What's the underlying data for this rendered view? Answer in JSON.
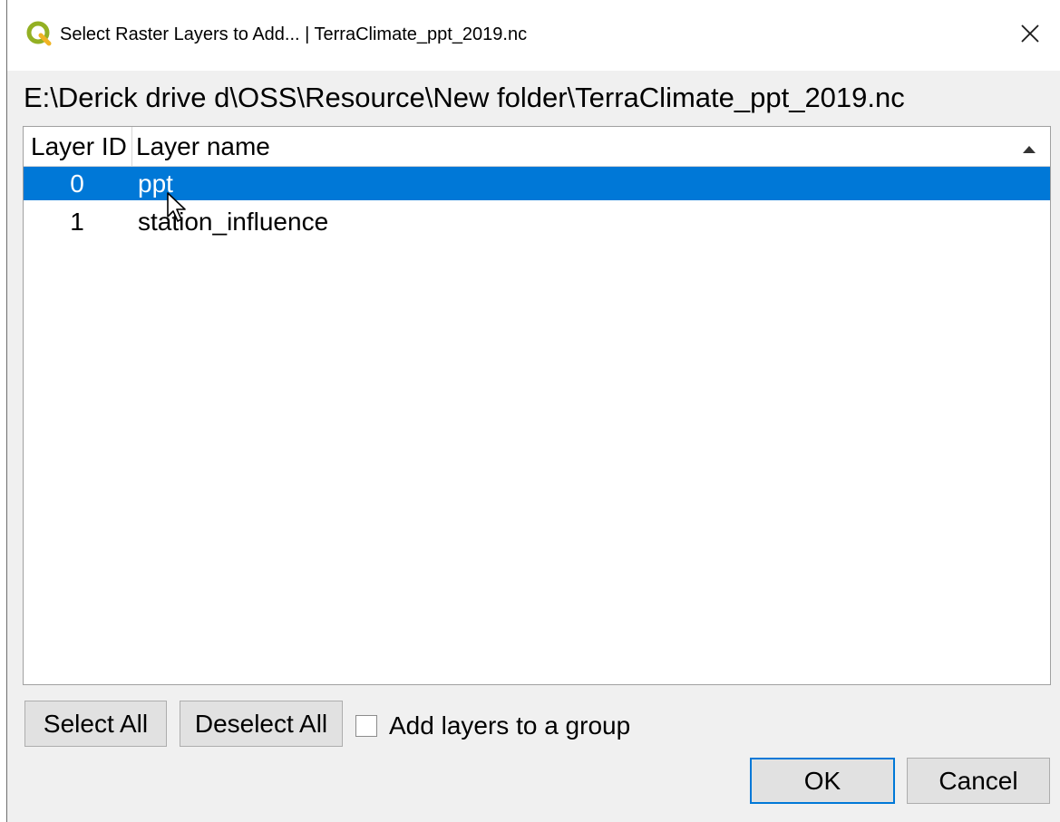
{
  "window": {
    "title": "Select Raster Layers to Add... | TerraClimate_ppt_2019.nc",
    "app_icon": "qgis-icon",
    "close_icon": "close-icon"
  },
  "path_label": "E:\\Derick drive d\\OSS\\Resource\\New folder\\TerraClimate_ppt_2019.nc",
  "table": {
    "columns": [
      "Layer ID",
      "Layer name"
    ],
    "sort_indicator": "sort-ascending-icon",
    "rows": [
      {
        "id": "0",
        "name": "ppt",
        "selected": true
      },
      {
        "id": "1",
        "name": "station_influence",
        "selected": false
      }
    ]
  },
  "buttons": {
    "select_all": "Select All",
    "deselect_all": "Deselect All",
    "ok": "OK",
    "cancel": "Cancel"
  },
  "add_to_group": {
    "label": "Add layers to a group",
    "checked": false
  },
  "colors": {
    "selection": "#0078d7",
    "qgis_green": "#93b023"
  }
}
